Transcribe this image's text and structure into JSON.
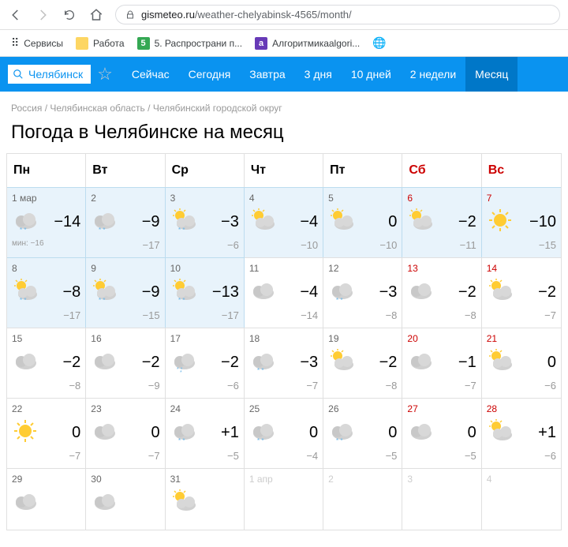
{
  "url": {
    "domain": "gismeteo.ru",
    "path": "/weather-chelyabinsk-4565/month/"
  },
  "bookmarks": {
    "services": "Сервисы",
    "work": "Работа",
    "spread": "5. Распространи п...",
    "algo": "Алгоритмикаalgori..."
  },
  "city": "Челябинск",
  "tabs": [
    "Сейчас",
    "Сегодня",
    "Завтра",
    "3 дня",
    "10 дней",
    "2 недели",
    "Месяц"
  ],
  "breadcrumb": [
    "Россия",
    "Челябинская область",
    "Челябинский городской округ"
  ],
  "title": "Погода в Челябинске на месяц",
  "dow": [
    "Пн",
    "Вт",
    "Ср",
    "Чт",
    "Пт",
    "Сб",
    "Вс"
  ],
  "min_label": "мин:",
  "days": [
    {
      "d": "1 мар",
      "icon": "cloud-snow",
      "hi": "−14",
      "lo": "−16",
      "past": true,
      "min": true
    },
    {
      "d": "2",
      "icon": "cloud-snow",
      "hi": "−9",
      "lo": "−17",
      "past": true
    },
    {
      "d": "3",
      "icon": "sun-cloud-snow",
      "hi": "−3",
      "lo": "−6",
      "past": true
    },
    {
      "d": "4",
      "icon": "sun-cloud",
      "hi": "−4",
      "lo": "−10",
      "past": true
    },
    {
      "d": "5",
      "icon": "sun-cloud",
      "hi": "0",
      "lo": "−10",
      "past": true
    },
    {
      "d": "6",
      "icon": "sun-cloud",
      "hi": "−2",
      "lo": "−11",
      "past": true,
      "weekend": true
    },
    {
      "d": "7",
      "icon": "sun",
      "hi": "−10",
      "lo": "−15",
      "past": true,
      "weekend": true
    },
    {
      "d": "8",
      "icon": "sun-cloud-snow",
      "hi": "−8",
      "lo": "−17",
      "past": true
    },
    {
      "d": "9",
      "icon": "sun-cloud-snow",
      "hi": "−9",
      "lo": "−15",
      "past": true
    },
    {
      "d": "10",
      "icon": "sun-cloud-snow",
      "hi": "−13",
      "lo": "−17",
      "past": true
    },
    {
      "d": "11",
      "icon": "cloud",
      "hi": "−4",
      "lo": "−14"
    },
    {
      "d": "12",
      "icon": "cloud-snow",
      "hi": "−3",
      "lo": "−8"
    },
    {
      "d": "13",
      "icon": "cloud",
      "hi": "−2",
      "lo": "−8",
      "weekend": true
    },
    {
      "d": "14",
      "icon": "sun-cloud",
      "hi": "−2",
      "lo": "−7",
      "weekend": true
    },
    {
      "d": "15",
      "icon": "cloud",
      "hi": "−2",
      "lo": "−8"
    },
    {
      "d": "16",
      "icon": "cloud",
      "hi": "−2",
      "lo": "−9"
    },
    {
      "d": "17",
      "icon": "cloud-heavy-snow",
      "hi": "−2",
      "lo": "−6"
    },
    {
      "d": "18",
      "icon": "cloud-snow",
      "hi": "−3",
      "lo": "−7"
    },
    {
      "d": "19",
      "icon": "sun-cloud",
      "hi": "−2",
      "lo": "−8"
    },
    {
      "d": "20",
      "icon": "cloud",
      "hi": "−1",
      "lo": "−7",
      "weekend": true
    },
    {
      "d": "21",
      "icon": "sun-cloud",
      "hi": "0",
      "lo": "−6",
      "weekend": true
    },
    {
      "d": "22",
      "icon": "sun",
      "hi": "0",
      "lo": "−7"
    },
    {
      "d": "23",
      "icon": "cloud",
      "hi": "0",
      "lo": "−7"
    },
    {
      "d": "24",
      "icon": "cloud-snow",
      "hi": "+1",
      "lo": "−5"
    },
    {
      "d": "25",
      "icon": "cloud-snow",
      "hi": "0",
      "lo": "−4"
    },
    {
      "d": "26",
      "icon": "cloud-snow",
      "hi": "0",
      "lo": "−5"
    },
    {
      "d": "27",
      "icon": "cloud",
      "hi": "0",
      "lo": "−5",
      "weekend": true
    },
    {
      "d": "28",
      "icon": "sun-cloud",
      "hi": "+1",
      "lo": "−6",
      "weekend": true
    },
    {
      "d": "29",
      "icon": "cloud"
    },
    {
      "d": "30",
      "icon": "cloud"
    },
    {
      "d": "31",
      "icon": "sun-cloud"
    },
    {
      "d": "1 апр",
      "other": true
    },
    {
      "d": "2",
      "other": true
    },
    {
      "d": "3",
      "other": true
    },
    {
      "d": "4",
      "other": true
    }
  ]
}
